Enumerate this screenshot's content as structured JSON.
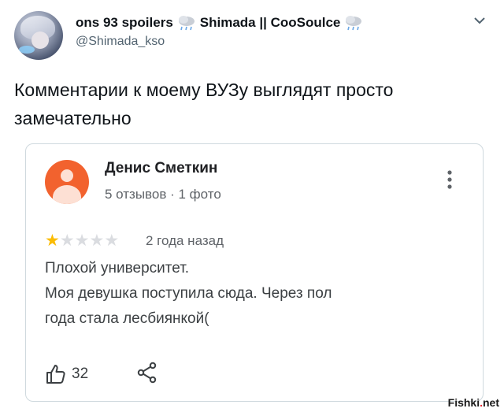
{
  "tweet": {
    "display_name": "ons 93 spoilers",
    "display_name_2": "Shimada || CooSoulce",
    "handle": "@Shimada_kso",
    "text": "Комментарии к моему ВУЗу выглядят просто замечательно"
  },
  "review": {
    "reviewer_name": "Денис Сметкин",
    "meta": "5 отзывов · 1 фото",
    "rating": 1,
    "rating_max": 5,
    "age": "2 года назад",
    "lines": [
      "Плохой университет.",
      "Моя девушка поступила сюда. Через пол",
      "года стала лесбиянкой("
    ],
    "likes": "32"
  },
  "watermark": {
    "text_main": "Fishki",
    "text_dot": ".",
    "text_tld": "net"
  },
  "colors": {
    "accent_avatar": "#f2622e",
    "star": "#fbbc04",
    "card_border": "#cfd9de"
  }
}
